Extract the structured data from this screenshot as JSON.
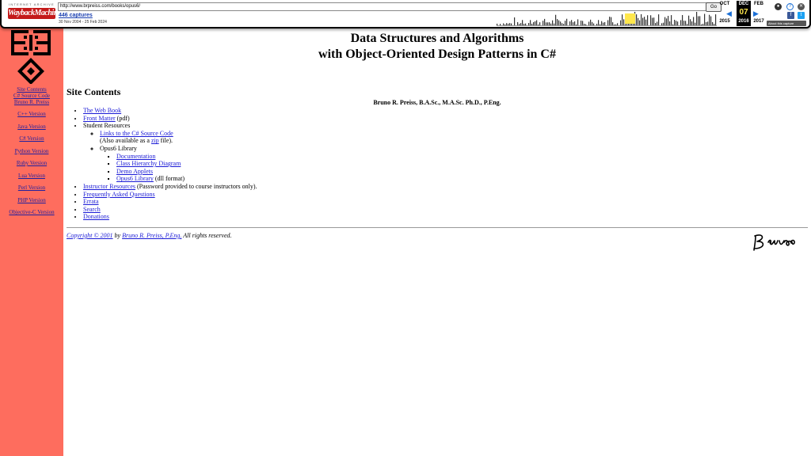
{
  "toolbar": {
    "ia_label": "INTERNET ARCHIVE",
    "wm_label": "WaybackMachine",
    "url": "http://www.brpreiss.com/books/opus6/",
    "go": "Go",
    "captures": "446 captures",
    "range": "30 Nov 2004 - 25 Feb 2024",
    "prev_month": "OCT",
    "cur_month": "DEC",
    "next_month": "FEB",
    "prev_year": "2015",
    "cur_year": "2016",
    "next_year": "2017",
    "day": "07",
    "about": "About this capture"
  },
  "sidebar": {
    "top_links": [
      "Site Contents",
      "C# Source Code",
      "Bruno R. Preiss"
    ],
    "versions": [
      "C++ Version",
      "Java Version",
      "C# Version",
      "Python Version",
      "Ruby Version",
      "Lua Version",
      "Perl Version",
      "PHP Version",
      "Objective-C Version"
    ]
  },
  "page": {
    "title_line1": "Data Structures and Algorithms",
    "title_line2": "with Object-Oriented Design Patterns in C#",
    "author": "Bruno R. Preiss, B.A.Sc., M.A.Sc. Ph.D., P.Eng.",
    "section_heading": "Site Contents",
    "toc": {
      "web_book": "The Web Book",
      "front_matter": "Front Matter",
      "front_matter_suffix": " (pdf)",
      "student_resources": "Student Resources",
      "links_source": "Links to the C# Source Code",
      "also_pre": "(Also available as a ",
      "zip": "zip",
      "also_post": " file).",
      "opus_library": "Opus6 Library",
      "documentation": "Documentation",
      "class_hierarchy": "Class Hierarchy Diagram",
      "demo_applets": "Demo Applets",
      "opus6_library_link": "Opus6 Library",
      "dll_suffix": " (dll format)",
      "instructor": "Instructor Resources",
      "instructor_suffix": " (Password provided to course instructors only).",
      "faq": "Frequently Asked Questions",
      "errata": "Errata",
      "search": "Search",
      "donations": "Donations"
    },
    "copyright_link": "Copyright © 2001",
    "copyright_by": " by ",
    "copyright_author": "Bruno R. Preiss, P.Eng.",
    "copyright_tail": " All rights reserved.",
    "signature": "BRuno"
  },
  "colors": {
    "sidebar_bg": "#fe6d5e",
    "link": "#1a1ad6",
    "wayback_red": "#c41a1a",
    "highlight": "#ffe74c"
  }
}
